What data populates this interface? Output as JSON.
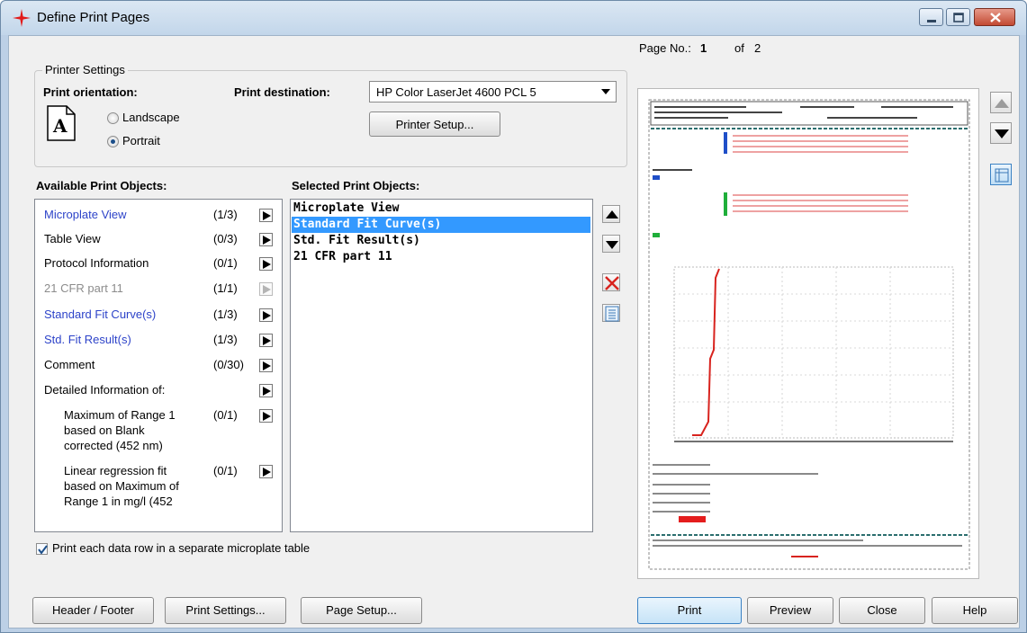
{
  "window": {
    "title": "Define Print Pages",
    "accent": "#e21b1b"
  },
  "printer_settings": {
    "group_label": "Printer Settings",
    "orientation_label": "Print orientation:",
    "landscape_label": "Landscape",
    "portrait_label": "Portrait",
    "selected_orientation": "Portrait",
    "destination_label": "Print destination:",
    "destination_value": "HP Color LaserJet 4600 PCL 5",
    "printer_setup_label": "Printer Setup..."
  },
  "available": {
    "header": "Available Print Objects:",
    "items": [
      {
        "label": "Microplate View",
        "count": "(1/3)",
        "style": "blue"
      },
      {
        "label": "Table View",
        "count": "(0/3)",
        "style": "normal"
      },
      {
        "label": "Protocol Information",
        "count": "(0/1)",
        "style": "normal"
      },
      {
        "label": "21 CFR part 11",
        "count": "(1/1)",
        "style": "gray"
      },
      {
        "label": "Standard Fit Curve(s)",
        "count": "(1/3)",
        "style": "blue"
      },
      {
        "label": "Std. Fit Result(s)",
        "count": "(1/3)",
        "style": "blue"
      },
      {
        "label": "Comment",
        "count": "(0/30)",
        "style": "normal"
      },
      {
        "label": "Detailed Information of:",
        "count": "",
        "style": "normal"
      }
    ],
    "sub_items": [
      {
        "lines": [
          "Maximum of Range 1",
          "based on Blank",
          "corrected (452 nm)"
        ],
        "count": "(0/1)"
      },
      {
        "lines": [
          "Linear regression fit",
          "based on Maximum of",
          "Range 1 in mg/l (452"
        ],
        "count": "(0/1)"
      }
    ]
  },
  "selected": {
    "header": "Selected Print Objects:",
    "items": [
      "Microplate View",
      "Standard Fit Curve(s)",
      "Std. Fit Result(s)",
      "21 CFR part 11"
    ],
    "highlighted_index": 1
  },
  "separate_table": {
    "label": "Print each data row in a separate microplate table",
    "checked": true
  },
  "page": {
    "label": "Page No.:",
    "current": "1",
    "of_label": "of",
    "total": "2"
  },
  "buttons": {
    "header_footer": "Header / Footer",
    "print_settings": "Print Settings...",
    "page_setup": "Page Setup...",
    "print": "Print",
    "preview": "Preview",
    "close": "Close",
    "help": "Help"
  },
  "colors": {
    "link_blue": "#2d43c9",
    "disabled_gray": "#8c8c8c",
    "selection": "#3399ff",
    "delete_red": "#d8231e"
  }
}
